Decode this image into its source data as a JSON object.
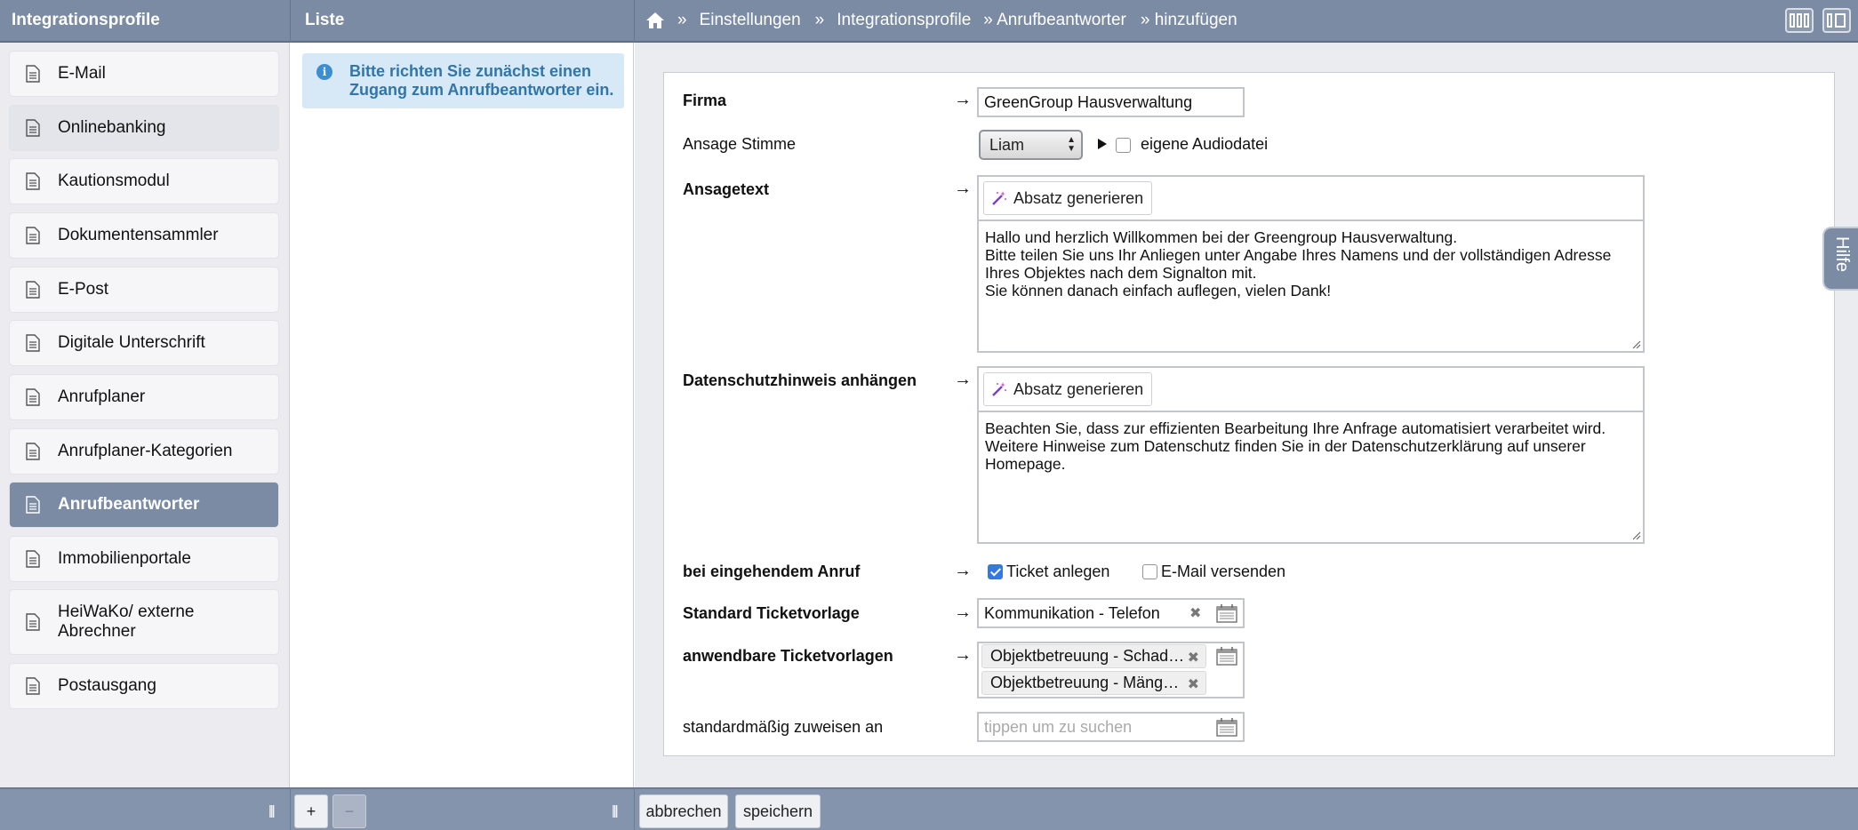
{
  "header": {
    "left_title": "Integrationsprofile",
    "mid_title": "Liste",
    "breadcrumb": [
      "»",
      "Einstellungen",
      "»",
      "Integrationsprofile",
      "» Anrufbeantworter",
      "» hinzufügen"
    ]
  },
  "sidebar": {
    "items": [
      {
        "label": "E-Mail"
      },
      {
        "label": "Onlinebanking"
      },
      {
        "label": "Kautionsmodul"
      },
      {
        "label": "Dokumentensammler"
      },
      {
        "label": "E-Post"
      },
      {
        "label": "Digitale Unterschrift"
      },
      {
        "label": "Anrufplaner"
      },
      {
        "label": "Anrufplaner-Kategorien"
      },
      {
        "label": "Anrufbeantworter"
      },
      {
        "label": "Immobilienportale"
      },
      {
        "label": "HeiWaKo/ externe Abrechner"
      },
      {
        "label": "Postausgang"
      }
    ]
  },
  "list": {
    "info": "Bitte richten Sie zunächst einen Zugang zum Anrufbeantworter ein."
  },
  "form": {
    "firma_label": "Firma",
    "firma_value": "GreenGroup Hausverwaltung",
    "stimme_label": "Ansage Stimme",
    "stimme_value": "Liam",
    "audio_label": "eigene Audiodatei",
    "ansagetext_label": "Ansagetext",
    "generate_label": "Absatz generieren",
    "ansagetext_value": "Hallo und herzlich Willkommen bei der Greengroup Hausverwaltung.\nBitte teilen Sie uns Ihr Anliegen unter Angabe Ihres Namens und der vollständigen Adresse Ihres Objektes nach dem Signalton mit.\nSie können danach einfach auflegen, vielen Dank!",
    "datenschutz_label": "Datenschutzhinweis anhängen",
    "datenschutz_value": "Beachten Sie, dass zur effizienten Bearbeitung Ihre Anfrage automatisiert verarbeitet wird. Weitere Hinweise zum Datenschutz finden Sie in der Datenschutzerklärung auf unserer Homepage.",
    "anruf_label": "bei eingehendem Anruf",
    "ticket_label": "Ticket anlegen",
    "email_label": "E-Mail versenden",
    "standard_vorlage_label": "Standard Ticketvorlage",
    "standard_vorlage_value": "Kommunikation - Telefon",
    "anwendbare_label": "anwendbare Ticketvorlagen",
    "anwendbare_tags": [
      "Objektbetreuung - Schad…",
      "Objektbetreuung - Mäng…"
    ],
    "zuweisen_label": "standardmäßig zuweisen an",
    "zuweisen_placeholder": "tippen um zu suchen"
  },
  "help_tab": "Hilfe",
  "footer": {
    "add": "+",
    "remove": "−",
    "cancel": "abbrechen",
    "save": "speichern"
  },
  "colors": {
    "header_bg": "#7b8ba4",
    "active_item": "#7b8ba4",
    "info_bg": "#d7e8f7",
    "info_text": "#3176a8",
    "checkbox_checked": "#3478e4"
  },
  "icons": [
    "home-icon",
    "document-icon",
    "info-icon",
    "magic-wand-icon",
    "play-icon",
    "remove-icon",
    "picker-icon",
    "layout-icon",
    "resize-grip-icon"
  ]
}
